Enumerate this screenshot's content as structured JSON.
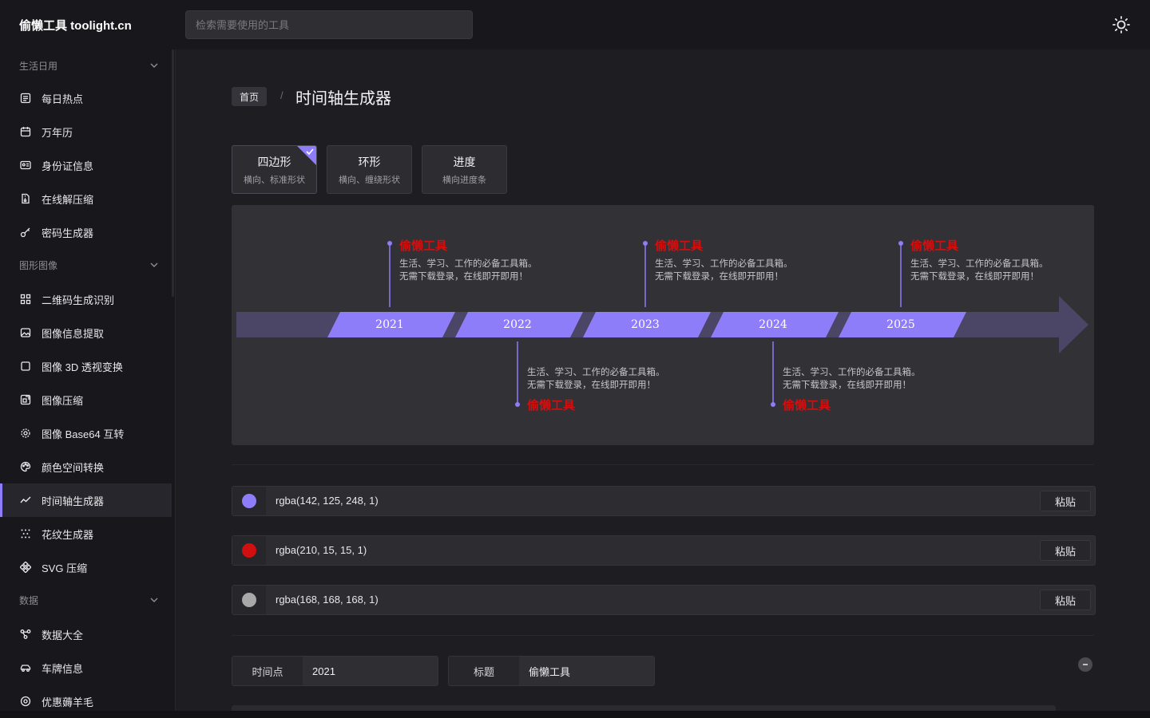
{
  "header": {
    "logo": "偷懒工具 toolight.cn",
    "search_placeholder": "检索需要使用的工具"
  },
  "sidebar": {
    "groups": [
      {
        "label": "生活日用",
        "items": [
          {
            "label": "每日热点",
            "icon": "list-icon"
          },
          {
            "label": "万年历",
            "icon": "calendar-icon"
          },
          {
            "label": "身份证信息",
            "icon": "id-card-icon"
          },
          {
            "label": "在线解压缩",
            "icon": "zip-file-icon"
          },
          {
            "label": "密码生成器",
            "icon": "key-icon"
          }
        ]
      },
      {
        "label": "图形图像",
        "items": [
          {
            "label": "二维码生成识别",
            "icon": "qrcode-icon"
          },
          {
            "label": "图像信息提取",
            "icon": "image-icon"
          },
          {
            "label": "图像 3D 透视变换",
            "icon": "square-icon"
          },
          {
            "label": "图像压缩",
            "icon": "image-compress-icon"
          },
          {
            "label": "图像 Base64 互转",
            "icon": "settings-icon"
          },
          {
            "label": "颜色空间转换",
            "icon": "palette-icon"
          },
          {
            "label": "时间轴生成器",
            "icon": "timeline-icon",
            "active": true
          },
          {
            "label": "花纹生成器",
            "icon": "dots-pattern-icon"
          },
          {
            "label": "SVG 压缩",
            "icon": "svg-icon"
          }
        ]
      },
      {
        "label": "数据",
        "items": [
          {
            "label": "数据大全",
            "icon": "data-icon"
          },
          {
            "label": "车牌信息",
            "icon": "car-icon"
          },
          {
            "label": "优惠薅羊毛",
            "icon": "coupon-icon"
          }
        ]
      }
    ]
  },
  "breadcrumb": {
    "home": "首页",
    "separator": "/",
    "current": "时间轴生成器"
  },
  "shapes": [
    {
      "title": "四边形",
      "subtitle": "横向、标准形状",
      "selected": true
    },
    {
      "title": "环形",
      "subtitle": "横向、缠绕形状",
      "selected": false
    },
    {
      "title": "进度",
      "subtitle": "横向进度条",
      "selected": false
    }
  ],
  "timeline": {
    "events": [
      {
        "year": "2021",
        "title": "偷懒工具",
        "desc1": "生活、学习、工作的必备工具箱。",
        "desc2": "无需下载登录，在线即开即用！",
        "side": "top"
      },
      {
        "year": "2022",
        "title": "偷懒工具",
        "desc1": "生活、学习、工作的必备工具箱。",
        "desc2": "无需下载登录，在线即开即用！",
        "side": "bottom"
      },
      {
        "year": "2023",
        "title": "偷懒工具",
        "desc1": "生活、学习、工作的必备工具箱。",
        "desc2": "无需下载登录，在线即开即用！",
        "side": "top"
      },
      {
        "year": "2024",
        "title": "偷懒工具",
        "desc1": "生活、学习、工作的必备工具箱。",
        "desc2": "无需下载登录，在线即开即用！",
        "side": "bottom"
      },
      {
        "year": "2025",
        "title": "偷懒工具",
        "desc1": "生活、学习、工作的必备工具箱。",
        "desc2": "无需下载登录，在线即开即用！",
        "side": "top"
      }
    ]
  },
  "colors": [
    {
      "value": "rgba(142, 125, 248, 1)",
      "hex": "#8e7df8",
      "paste_label": "粘贴"
    },
    {
      "value": "rgba(210, 15, 15, 1)",
      "hex": "#d20f0f",
      "paste_label": "粘贴"
    },
    {
      "value": "rgba(168, 168, 168, 1)",
      "hex": "#a8a8a8",
      "paste_label": "粘贴"
    }
  ],
  "event_editor": {
    "time_label": "时间点",
    "time_value": "2021",
    "title_label": "标题",
    "title_value": "偷懒工具"
  },
  "theme": {
    "bg": "#18181c",
    "main_bg": "#1e1e22",
    "accent": "#8e7df8",
    "title_red": "#d20f0f"
  }
}
